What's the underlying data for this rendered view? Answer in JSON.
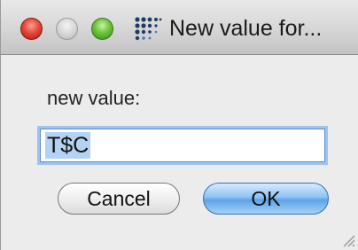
{
  "window": {
    "title": "New value for..."
  },
  "dialog": {
    "prompt": "new value:",
    "value": "T$C",
    "cancel_label": "Cancel",
    "ok_label": "OK"
  },
  "icons": {
    "close": "close-button",
    "minimize": "minimize-button",
    "zoom": "zoom-button",
    "app": "dot-grid-app-icon",
    "resize": "resize-grip-icon"
  },
  "colors": {
    "close": "#e34a3b",
    "zoom": "#6cc43b",
    "ok_button": "#5da3e8",
    "selection": "#b5d2f5"
  }
}
